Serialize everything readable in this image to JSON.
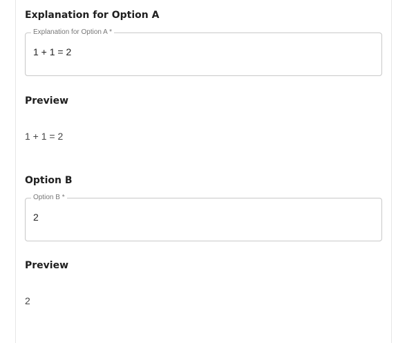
{
  "option_a_explanation": {
    "title": "Explanation for Option A",
    "field_label": "Explanation for Option A *",
    "field_value": "1 + 1 = 2",
    "preview_title": "Preview",
    "preview_text": "1 + 1 = 2"
  },
  "option_b": {
    "title": "Option B",
    "field_label": "Option B *",
    "field_value": "2",
    "preview_title": "Preview",
    "preview_text": "2"
  }
}
